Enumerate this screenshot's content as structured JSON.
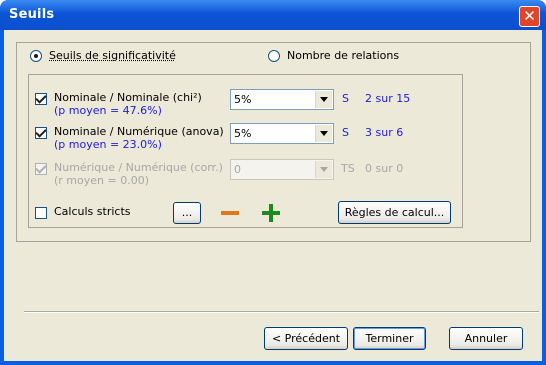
{
  "window": {
    "title": "Seuils",
    "close_glyph": "✕"
  },
  "mode": {
    "option_significance": "Seuils de significativité",
    "option_relations": "Nombre de relations",
    "selected": "significance"
  },
  "thresholds": [
    {
      "label": "Nominale / Nominale (chi²)",
      "sub": "(p moyen = 47.6%)",
      "value": "5%",
      "code": "S",
      "count": "2 sur 15",
      "checked": true,
      "enabled": true
    },
    {
      "label": "Nominale / Numérique (anova)",
      "sub": "(p moyen = 23.0%)",
      "value": "5%",
      "code": "S",
      "count": "3 sur 6",
      "checked": true,
      "enabled": true
    },
    {
      "label": "Numérique / Numérique (corr.)",
      "sub": "(r moyen = 0.00)",
      "value": "0",
      "code": "TS",
      "count": "0 sur 0",
      "checked": true,
      "enabled": false
    }
  ],
  "strict": {
    "label": "Calculs stricts",
    "checked": false,
    "ellipsis_label": "...",
    "rules_label": "Règles de calcul..."
  },
  "icons": {
    "minus": "minus-icon",
    "plus": "plus-icon",
    "minus_color": "#e07820",
    "plus_color": "#1e8a1e"
  },
  "footer": {
    "prev_label": "< Précédent",
    "finish_label": "Terminer",
    "cancel_label": "Annuler"
  }
}
